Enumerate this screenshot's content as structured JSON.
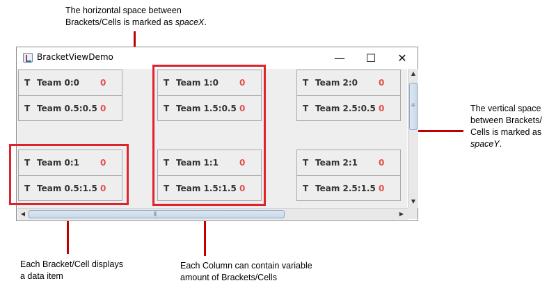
{
  "window": {
    "title": "BracketViewDemo",
    "controls": {
      "minimize": "—",
      "maximize": "☐",
      "close": "✕"
    }
  },
  "cells": [
    {
      "t1": "T",
      "team1": "Team 0:0",
      "score1": "0",
      "t2": "T",
      "team2": "Team 0.5:0.5",
      "score2": "0"
    },
    {
      "t1": "T",
      "team1": "Team 1:0",
      "score1": "0",
      "t2": "T",
      "team2": "Team 1.5:0.5",
      "score2": "0"
    },
    {
      "t1": "T",
      "team1": "Team 2:0",
      "score1": "0",
      "t2": "T",
      "team2": "Team 2.5:0.5",
      "score2": "0"
    },
    {
      "t1": "T",
      "team1": "Team 0:1",
      "score1": "0",
      "t2": "T",
      "team2": "Team 0.5:1.5",
      "score2": "0"
    },
    {
      "t1": "T",
      "team1": "Team 1:1",
      "score1": "0",
      "t2": "T",
      "team2": "Team 1.5:1.5",
      "score2": "0"
    },
    {
      "t1": "T",
      "team1": "Team 2:1",
      "score1": "0",
      "t2": "T",
      "team2": "Team 2.5:1.5",
      "score2": "0"
    }
  ],
  "annotations": {
    "spacex_line1": "The horizontal space between",
    "spacex_line2": "Brackets/Cells is marked as ",
    "spacex_italic": "spaceX",
    "spacex_end": ".",
    "spacey_line1": "The vertical space",
    "spacey_line2": "between Brackets/",
    "spacey_line3": "Cells is marked as",
    "spacey_italic": "spaceY",
    "spacey_end": ".",
    "cell_line1": "Each Bracket/Cell displays",
    "cell_line2": "a data item",
    "column_line1": "Each Column can contain  variable",
    "column_line2": "amount of Brackets/Cells"
  },
  "colors": {
    "annotation_red": "#e0222a",
    "score_red": "#e05050",
    "panel_bg": "#eeeeee"
  }
}
